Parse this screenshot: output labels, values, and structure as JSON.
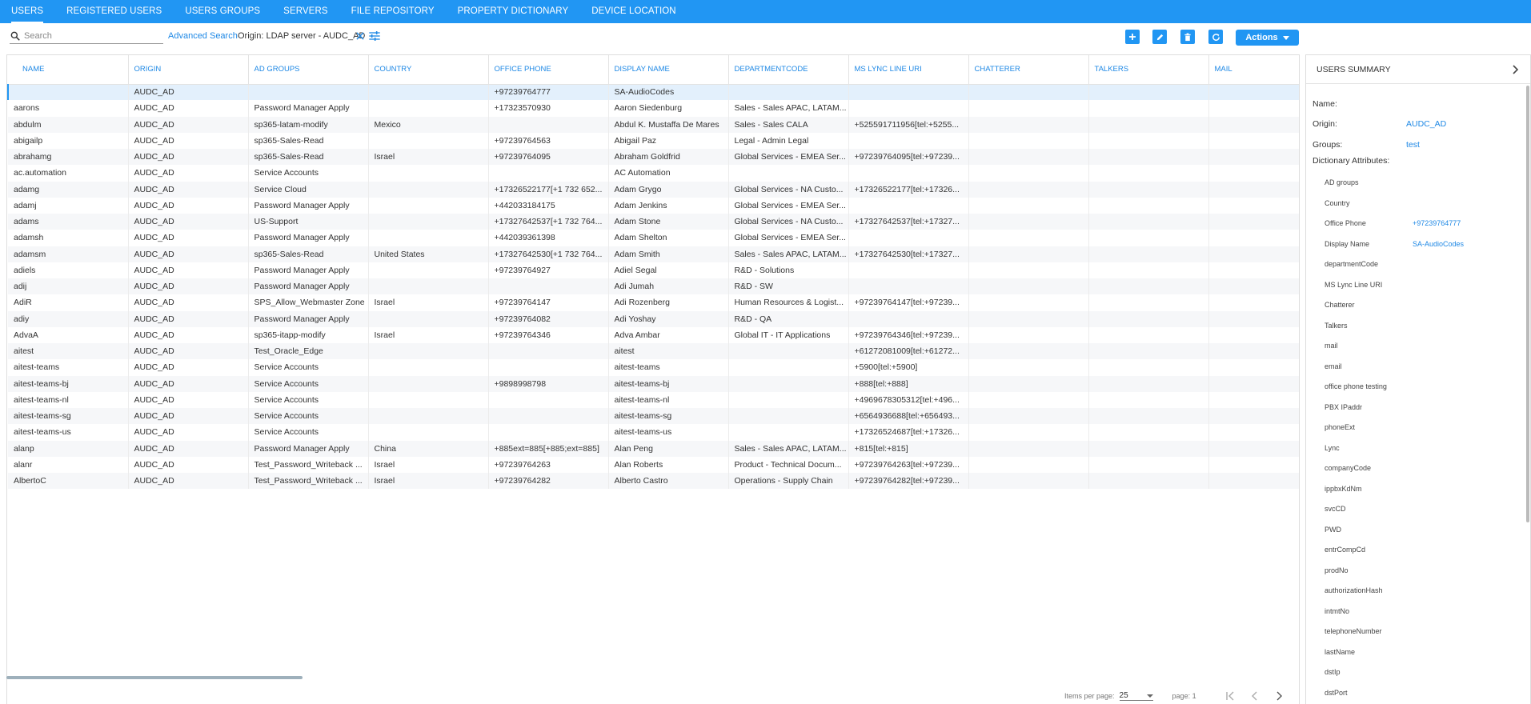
{
  "nav": {
    "tabs": [
      "USERS",
      "REGISTERED USERS",
      "USERS GROUPS",
      "SERVERS",
      "FILE REPOSITORY",
      "PROPERTY DICTIONARY",
      "DEVICE LOCATION"
    ],
    "active": "USERS"
  },
  "toolbar": {
    "search_placeholder": "Search",
    "advanced_search": "Advanced Search",
    "origin_filter": "Origin: LDAP server - AUDC_AD",
    "actions_label": "Actions"
  },
  "table": {
    "columns": [
      "NAME",
      "ORIGIN",
      "AD GROUPS",
      "COUNTRY",
      "OFFICE PHONE",
      "DISPLAY NAME",
      "DEPARTMENTCODE",
      "MS LYNC LINE URI",
      "CHATTERER",
      "TALKERS",
      "MAIL"
    ],
    "rows": [
      [
        "",
        "AUDC_AD",
        "",
        "",
        "+97239764777",
        "SA-AudioCodes",
        "",
        "",
        "",
        "",
        ""
      ],
      [
        "aarons",
        "AUDC_AD",
        "Password Manager Apply",
        "",
        "+17323570930",
        "Aaron Siedenburg",
        "Sales - Sales APAC, LATAM...",
        "",
        "",
        "",
        ""
      ],
      [
        "abdulm",
        "AUDC_AD",
        "sp365-latam-modify",
        "Mexico",
        "",
        "Abdul K. Mustaffa De Mares",
        "Sales - Sales CALA",
        "+525591711956[tel:+5255...",
        "",
        "",
        ""
      ],
      [
        "abigailp",
        "AUDC_AD",
        "sp365-Sales-Read",
        "",
        "+97239764563",
        "Abigail Paz",
        "Legal - Admin Legal",
        "",
        "",
        "",
        ""
      ],
      [
        "abrahamg",
        "AUDC_AD",
        "sp365-Sales-Read",
        "Israel",
        "+97239764095",
        "Abraham Goldfrid",
        "Global Services - EMEA Ser...",
        "+97239764095[tel:+97239...",
        "",
        "",
        ""
      ],
      [
        "ac.automation",
        "AUDC_AD",
        "Service Accounts",
        "",
        "",
        "AC Automation",
        "",
        "",
        "",
        "",
        ""
      ],
      [
        "adamg",
        "AUDC_AD",
        "Service Cloud",
        "",
        "+17326522177[+1 732 652...",
        "Adam Grygo",
        "Global Services - NA Custo...",
        "+17326522177[tel:+17326...",
        "",
        "",
        ""
      ],
      [
        "adamj",
        "AUDC_AD",
        "Password Manager Apply",
        "",
        "+442033184175",
        "Adam Jenkins",
        "Global Services - EMEA Ser...",
        "",
        "",
        "",
        ""
      ],
      [
        "adams",
        "AUDC_AD",
        "US-Support",
        "",
        "+17327642537[+1 732 764...",
        "Adam Stone",
        "Global Services - NA Custo...",
        "+17327642537[tel:+17327...",
        "",
        "",
        ""
      ],
      [
        "adamsh",
        "AUDC_AD",
        "Password Manager Apply",
        "",
        "+442039361398",
        "Adam Shelton",
        "Global Services - EMEA Ser...",
        "",
        "",
        "",
        ""
      ],
      [
        "adamsm",
        "AUDC_AD",
        "sp365-Sales-Read",
        "United States",
        "+17327642530[+1 732 764...",
        "Adam Smith",
        "Sales - Sales APAC, LATAM...",
        "+17327642530[tel:+17327...",
        "",
        "",
        ""
      ],
      [
        "adiels",
        "AUDC_AD",
        "Password Manager Apply",
        "",
        "+97239764927",
        "Adiel Segal",
        "R&D - Solutions",
        "",
        "",
        "",
        ""
      ],
      [
        "adij",
        "AUDC_AD",
        "Password Manager Apply",
        "",
        "",
        "Adi Jumah",
        "R&D - SW",
        "",
        "",
        "",
        ""
      ],
      [
        "AdiR",
        "AUDC_AD",
        "SPS_Allow_Webmaster Zone",
        "Israel",
        "+97239764147",
        "Adi Rozenberg",
        "Human Resources & Logist...",
        "+97239764147[tel:+97239...",
        "",
        "",
        ""
      ],
      [
        "adiy",
        "AUDC_AD",
        "Password Manager Apply",
        "",
        "+97239764082",
        "Adi Yoshay",
        "R&D - QA",
        "",
        "",
        "",
        ""
      ],
      [
        "AdvaA",
        "AUDC_AD",
        "sp365-itapp-modify",
        "Israel",
        "+97239764346",
        "Adva Ambar",
        "Global IT - IT Applications",
        "+97239764346[tel:+97239...",
        "",
        "",
        ""
      ],
      [
        "aitest",
        "AUDC_AD",
        "Test_Oracle_Edge",
        "",
        "",
        "aitest",
        "",
        "+61272081009[tel:+61272...",
        "",
        "",
        ""
      ],
      [
        "aitest-teams",
        "AUDC_AD",
        "Service Accounts",
        "",
        "",
        "aitest-teams",
        "",
        "+5900[tel:+5900]",
        "",
        "",
        ""
      ],
      [
        "aitest-teams-bj",
        "AUDC_AD",
        "Service Accounts",
        "",
        "+9898998798",
        "aitest-teams-bj",
        "",
        "+888[tel:+888]",
        "",
        "",
        ""
      ],
      [
        "aitest-teams-nl",
        "AUDC_AD",
        "Service Accounts",
        "",
        "",
        "aitest-teams-nl",
        "",
        "+4969678305312[tel:+496...",
        "",
        "",
        ""
      ],
      [
        "aitest-teams-sg",
        "AUDC_AD",
        "Service Accounts",
        "",
        "",
        "aitest-teams-sg",
        "",
        "+6564936688[tel:+656493...",
        "",
        "",
        ""
      ],
      [
        "aitest-teams-us",
        "AUDC_AD",
        "Service Accounts",
        "",
        "",
        "aitest-teams-us",
        "",
        "+17326524687[tel:+17326...",
        "",
        "",
        ""
      ],
      [
        "alanp",
        "AUDC_AD",
        "Password Manager Apply",
        "China",
        "+885ext=885[+885;ext=885]",
        "Alan Peng",
        "Sales - Sales APAC, LATAM...",
        "+815[tel:+815]",
        "",
        "",
        ""
      ],
      [
        "alanr",
        "AUDC_AD",
        "Test_Password_Writeback ...",
        "Israel",
        "+97239764263",
        "Alan Roberts",
        "Product - Technical Docum...",
        "+97239764263[tel:+97239...",
        "",
        "",
        ""
      ],
      [
        "AlbertoC",
        "AUDC_AD",
        "Test_Password_Writeback ...",
        "Israel",
        "+97239764282",
        "Alberto Castro",
        "Operations - Supply Chain",
        "+97239764282[tel:+97239...",
        "",
        "",
        ""
      ]
    ]
  },
  "pager": {
    "items_per_page_label": "Items per page:",
    "items_per_page": "25",
    "page_label": "page: 1"
  },
  "summary": {
    "title": "USERS SUMMARY",
    "fields": [
      {
        "key": "Name:",
        "value": ""
      },
      {
        "key": "Origin:",
        "value": "AUDC_AD"
      },
      {
        "key": "Groups:",
        "value": "test"
      }
    ],
    "dict_title": "Dictionary Attributes:",
    "attributes": [
      {
        "key": "AD groups",
        "value": ""
      },
      {
        "key": "Country",
        "value": ""
      },
      {
        "key": "Office Phone",
        "value": "+97239764777"
      },
      {
        "key": "Display Name",
        "value": "SA-AudioCodes"
      },
      {
        "key": "departmentCode",
        "value": ""
      },
      {
        "key": "MS Lync Line URI",
        "value": ""
      },
      {
        "key": "Chatterer",
        "value": ""
      },
      {
        "key": "Talkers",
        "value": ""
      },
      {
        "key": "mail",
        "value": ""
      },
      {
        "key": "email",
        "value": ""
      },
      {
        "key": "office phone testing",
        "value": ""
      },
      {
        "key": "PBX IPaddr",
        "value": ""
      },
      {
        "key": "phoneExt",
        "value": ""
      },
      {
        "key": "Lync",
        "value": ""
      },
      {
        "key": "companyCode",
        "value": ""
      },
      {
        "key": "ippbxKdNm",
        "value": ""
      },
      {
        "key": "svcCD",
        "value": ""
      },
      {
        "key": "PWD",
        "value": ""
      },
      {
        "key": "entrCompCd",
        "value": ""
      },
      {
        "key": "prodNo",
        "value": ""
      },
      {
        "key": "authorizationHash",
        "value": ""
      },
      {
        "key": "intmtNo",
        "value": ""
      },
      {
        "key": "telephoneNumber",
        "value": ""
      },
      {
        "key": "lastName",
        "value": ""
      },
      {
        "key": "dstIp",
        "value": ""
      },
      {
        "key": "dstPort",
        "value": ""
      }
    ]
  },
  "colors": {
    "accent": "#2196f3",
    "link": "#1e88e5",
    "row_alt": "#f6f7f9",
    "row_selected": "#e3f0fc"
  },
  "icons": {
    "search": "search-icon",
    "clear": "close-icon",
    "filter": "tune-icon",
    "add": "plus-icon",
    "edit": "pencil-icon",
    "delete": "trash-icon",
    "refresh": "refresh-icon",
    "expand": "chevron-right-icon"
  }
}
